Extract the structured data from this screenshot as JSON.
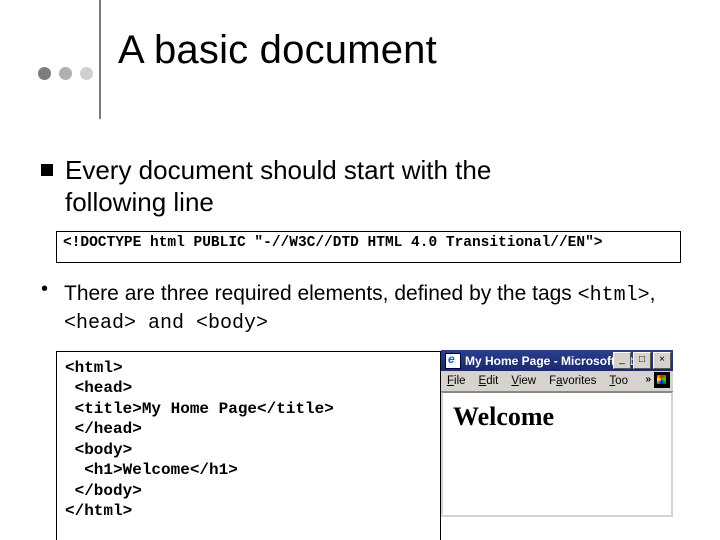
{
  "title": "A basic document",
  "bullet1": {
    "line1": "Every document should start with the",
    "line2": "following line"
  },
  "doctype_code": "<!DOCTYPE html PUBLIC \"-//W3C//DTD HTML 4.0 Transitional//EN\">",
  "bullet2": {
    "pre": "There are three required elements, defined by the tags ",
    "t1": "<html>",
    "mid1": ", ",
    "t2": "<head>",
    "mid2": " and ",
    "t3": "<body>"
  },
  "code_example": "<html>\n <head>\n <title>My Home Page</title>\n </head>\n <body>\n  <h1>Welcome</h1>\n </body>\n</html>",
  "browser": {
    "title": "My Home Page - Microsoft Int…",
    "menu": {
      "file": "File",
      "edit": "Edit",
      "view": "View",
      "favorites": "Favorites",
      "tools": "Too"
    },
    "chev": "»",
    "btn_min": "_",
    "btn_max": "□",
    "btn_close": "×",
    "page_heading": "Welcome"
  }
}
